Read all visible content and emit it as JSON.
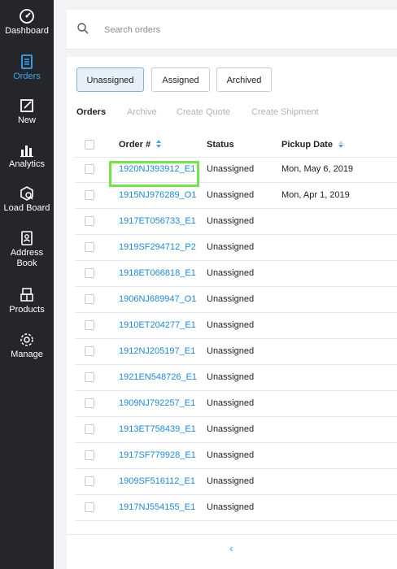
{
  "sidebar": {
    "items": [
      {
        "label": "Dashboard",
        "icon": "dashboard-icon"
      },
      {
        "label": "Orders",
        "icon": "orders-icon",
        "active": true
      },
      {
        "label": "New",
        "icon": "new-icon"
      },
      {
        "label": "Analytics",
        "icon": "analytics-icon"
      },
      {
        "label": "Load Board",
        "icon": "load-board-icon"
      },
      {
        "label": "Address Book",
        "icon": "address-book-icon"
      },
      {
        "label": "Products",
        "icon": "products-icon"
      },
      {
        "label": "Manage",
        "icon": "gear-icon"
      }
    ]
  },
  "search": {
    "placeholder": "Search orders"
  },
  "segments": [
    {
      "label": "Unassigned",
      "active": true
    },
    {
      "label": "Assigned"
    },
    {
      "label": "Archived"
    }
  ],
  "subtabs": [
    {
      "label": "Orders",
      "active": true
    },
    {
      "label": "Archive"
    },
    {
      "label": "Create Quote"
    },
    {
      "label": "Create Shipment"
    }
  ],
  "table": {
    "headers": {
      "order": "Order #",
      "status": "Status",
      "pickup": "Pickup Date"
    },
    "rows": [
      {
        "order": "1920NJ393912_E1",
        "status": "Unassigned",
        "pickup": "Mon, May 6, 2019"
      },
      {
        "order": "1915NJ976289_O1",
        "status": "Unassigned",
        "pickup": "Mon, Apr 1, 2019"
      },
      {
        "order": "1917ET056733_E1",
        "status": "Unassigned",
        "pickup": ""
      },
      {
        "order": "1919SF294712_P2",
        "status": "Unassigned",
        "pickup": ""
      },
      {
        "order": "1918ET066818_E1",
        "status": "Unassigned",
        "pickup": ""
      },
      {
        "order": "1906NJ689947_O1",
        "status": "Unassigned",
        "pickup": ""
      },
      {
        "order": "1910ET204277_E1",
        "status": "Unassigned",
        "pickup": ""
      },
      {
        "order": "1912NJ205197_E1",
        "status": "Unassigned",
        "pickup": ""
      },
      {
        "order": "1921EN548726_E1",
        "status": "Unassigned",
        "pickup": ""
      },
      {
        "order": "1909NJ792257_E1",
        "status": "Unassigned",
        "pickup": ""
      },
      {
        "order": "1913ET758439_E1",
        "status": "Unassigned",
        "pickup": ""
      },
      {
        "order": "1917SF779928_E1",
        "status": "Unassigned",
        "pickup": ""
      },
      {
        "order": "1909SF516112_E1",
        "status": "Unassigned",
        "pickup": ""
      },
      {
        "order": "1917NJ554155_E1",
        "status": "Unassigned",
        "pickup": ""
      }
    ]
  },
  "pager": {
    "prev_icon": "chevron-left-icon"
  },
  "colors": {
    "sidebar_bg": "#25262b",
    "accent": "#1e88d8",
    "active_nav": "#3aa7f0",
    "highlight": "#74e34c"
  }
}
